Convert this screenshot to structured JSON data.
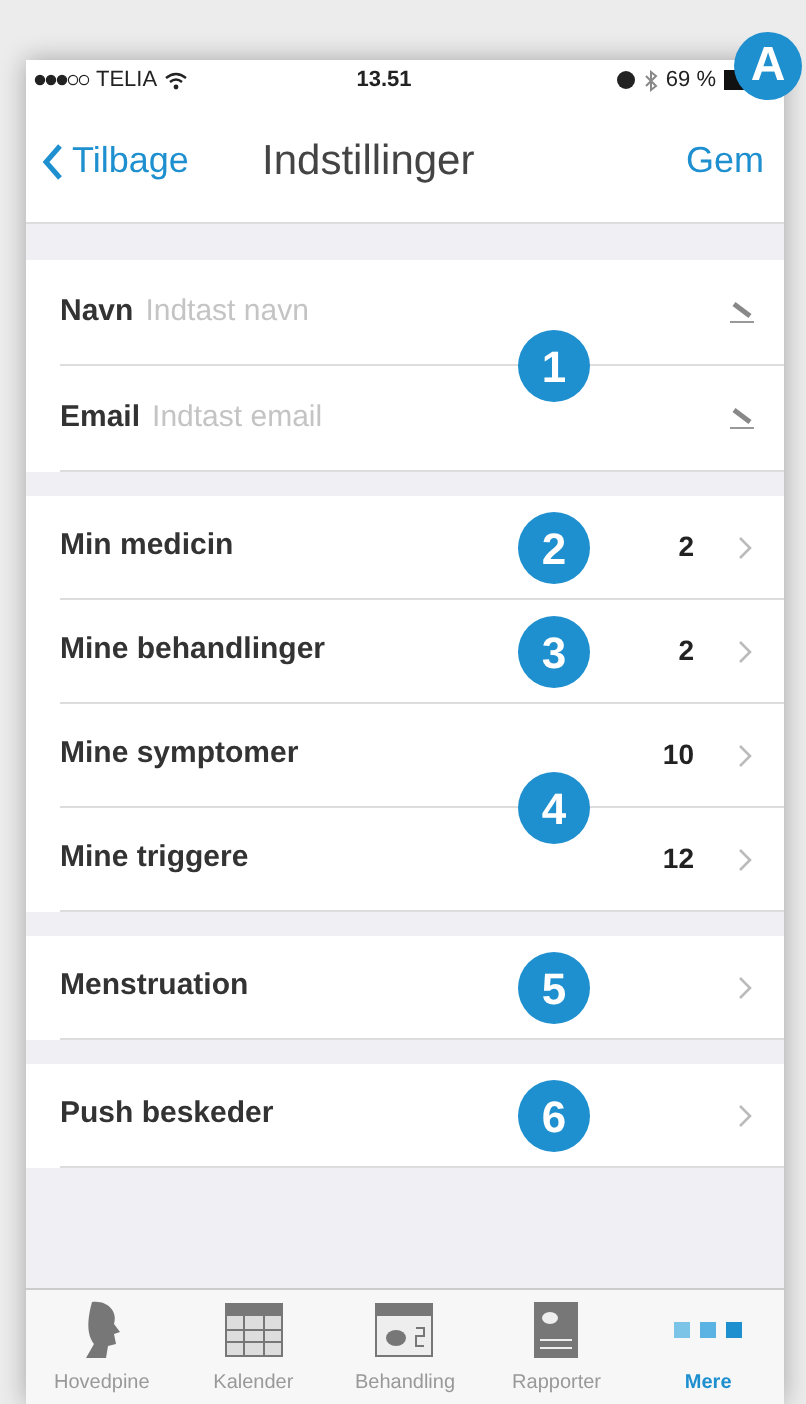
{
  "corner_marker": "A",
  "status_bar": {
    "carrier": "TELIA",
    "time": "13.51",
    "battery": "69 %"
  },
  "nav": {
    "back": "Tilbage",
    "title": "Indstillinger",
    "action": "Gem"
  },
  "sections": [
    {
      "blocks": [
        {
          "marker": "1",
          "rows": [
            {
              "kind": "field",
              "label": "Navn",
              "placeholder": "Indtast navn"
            },
            {
              "kind": "field",
              "label": "Email",
              "placeholder": "Indtast email"
            }
          ]
        }
      ]
    },
    {
      "blocks": [
        {
          "marker": "2",
          "rows": [
            {
              "kind": "link",
              "label": "Min medicin",
              "value": "2"
            }
          ]
        },
        {
          "marker": "3",
          "rows": [
            {
              "kind": "link",
              "label": "Mine behandlinger",
              "value": "2"
            }
          ]
        },
        {
          "marker": "4",
          "rows": [
            {
              "kind": "link",
              "label": "Mine symptomer",
              "value": "10"
            },
            {
              "kind": "link",
              "label": "Mine triggere",
              "value": "12"
            }
          ]
        }
      ]
    },
    {
      "blocks": [
        {
          "marker": "5",
          "rows": [
            {
              "kind": "link",
              "label": "Menstruation"
            }
          ]
        }
      ]
    },
    {
      "blocks": [
        {
          "marker": "6",
          "rows": [
            {
              "kind": "link",
              "label": "Push beskeder"
            }
          ]
        }
      ]
    }
  ],
  "tab_bar": [
    {
      "kind": "head",
      "label": "Hovedpine",
      "selected": false
    },
    {
      "kind": "calendar",
      "label": "Kalender",
      "selected": false
    },
    {
      "kind": "treatment",
      "label": "Behandling",
      "selected": false
    },
    {
      "kind": "report",
      "label": "Rapporter",
      "selected": false
    },
    {
      "kind": "more",
      "label": "Mere",
      "selected": true
    }
  ]
}
